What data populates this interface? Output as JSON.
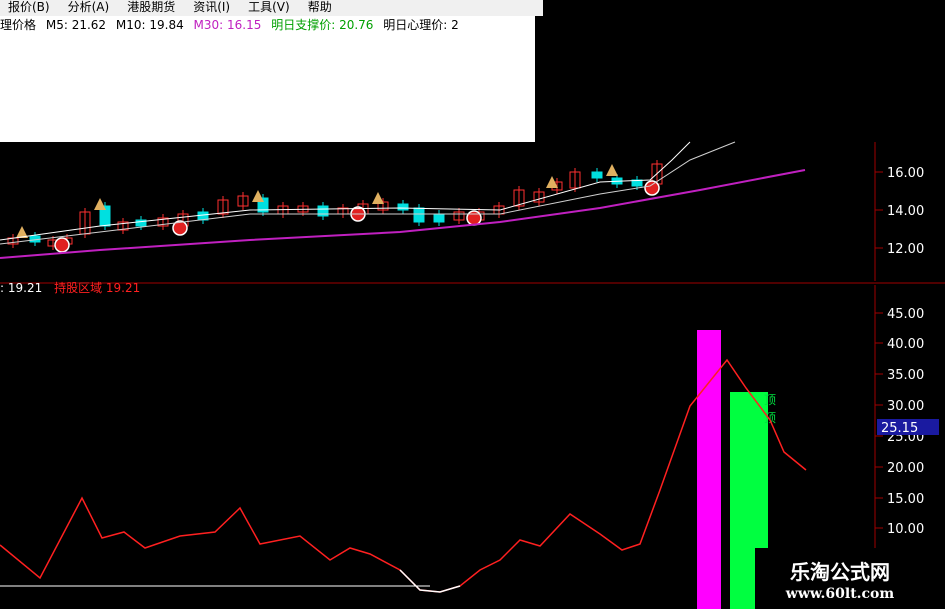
{
  "menu": {
    "items": [
      "报价(B)",
      "分析(A)",
      "港股期货",
      "资讯(I)",
      "工具(V)",
      "帮助"
    ]
  },
  "info": {
    "label_prefix": "理价格",
    "m5_label": "M5: 21.62",
    "m10_label": "M10: 19.84",
    "m30_label": "M30: 16.15",
    "support_label": "明日支撑价: 20.76",
    "psych_label": "明日心理价: 2"
  },
  "indicator": {
    "value_label": "19.21",
    "zone_label": "持股区域",
    "zone_value": "19.21",
    "current_value_box": "25.15",
    "bar_text": "顶"
  },
  "upper_axis": {
    "ticks": [
      "16.00",
      "14.00",
      "12.00"
    ]
  },
  "lower_axis": {
    "ticks": [
      "45.00",
      "40.00",
      "35.00",
      "30.00",
      "25.00",
      "20.00",
      "15.00",
      "10.00"
    ]
  },
  "watermark": {
    "line1": "乐淘公式网",
    "line2": "www.60lt.com"
  },
  "colors": {
    "background": "#000000",
    "axis": "#a00000",
    "up_candle": "#ff3030",
    "down_candle": "#00e0e0",
    "ma_purple": "#c020c0",
    "ma_white": "#ffffff",
    "magenta_bar": "#ff00ff",
    "green_bar": "#00ff40",
    "indicator_line": "#ff2020"
  }
}
